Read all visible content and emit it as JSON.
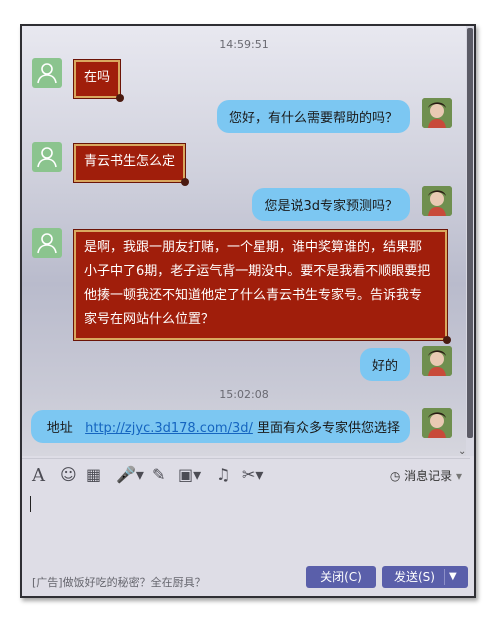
{
  "messages": [
    {
      "type": "timestamp",
      "text": "14:59:51"
    },
    {
      "type": "in",
      "text": "在吗"
    },
    {
      "type": "out",
      "text": "您好，有什么需要帮助的吗？"
    },
    {
      "type": "in",
      "text": "青云书生怎么定"
    },
    {
      "type": "out",
      "text": "您是说3d专家预测吗？"
    },
    {
      "type": "in",
      "lines": [
        "是啊，我跟一朋友打赌，一个星期，谁中奖算谁的，结果那",
        "小子中了6期，老子运气背一期没中。要不是我看不顺眼要把",
        "他揍一顿我还不知道他定了什么青云书生专家号。告诉我专",
        "家号在网站什么位置？"
      ]
    },
    {
      "type": "out",
      "text": "好的"
    },
    {
      "type": "timestamp",
      "text": "15:02:08"
    },
    {
      "type": "out",
      "prefix": "地址",
      "link": "http://zjyc.3d178.com/3d/",
      "suffix": " 里面有众多专家供您选择"
    }
  ],
  "toolbar": {
    "icons": [
      "font-icon",
      "emoji-icon",
      "screenshot-icon",
      "voice-icon",
      "edit-icon",
      "image-icon",
      "music-icon",
      "scissors-icon"
    ],
    "history_label": "消息记录"
  },
  "footer": {
    "ad_text": "[广告]做饭好吃的秘密？全在厨具？",
    "close_label": "关闭(C)",
    "send_label": "发送(S)"
  },
  "colors": {
    "incoming_bubble": "#a01e0b",
    "outgoing_bubble": "#7cc7f2",
    "button": "#5a5faa"
  }
}
